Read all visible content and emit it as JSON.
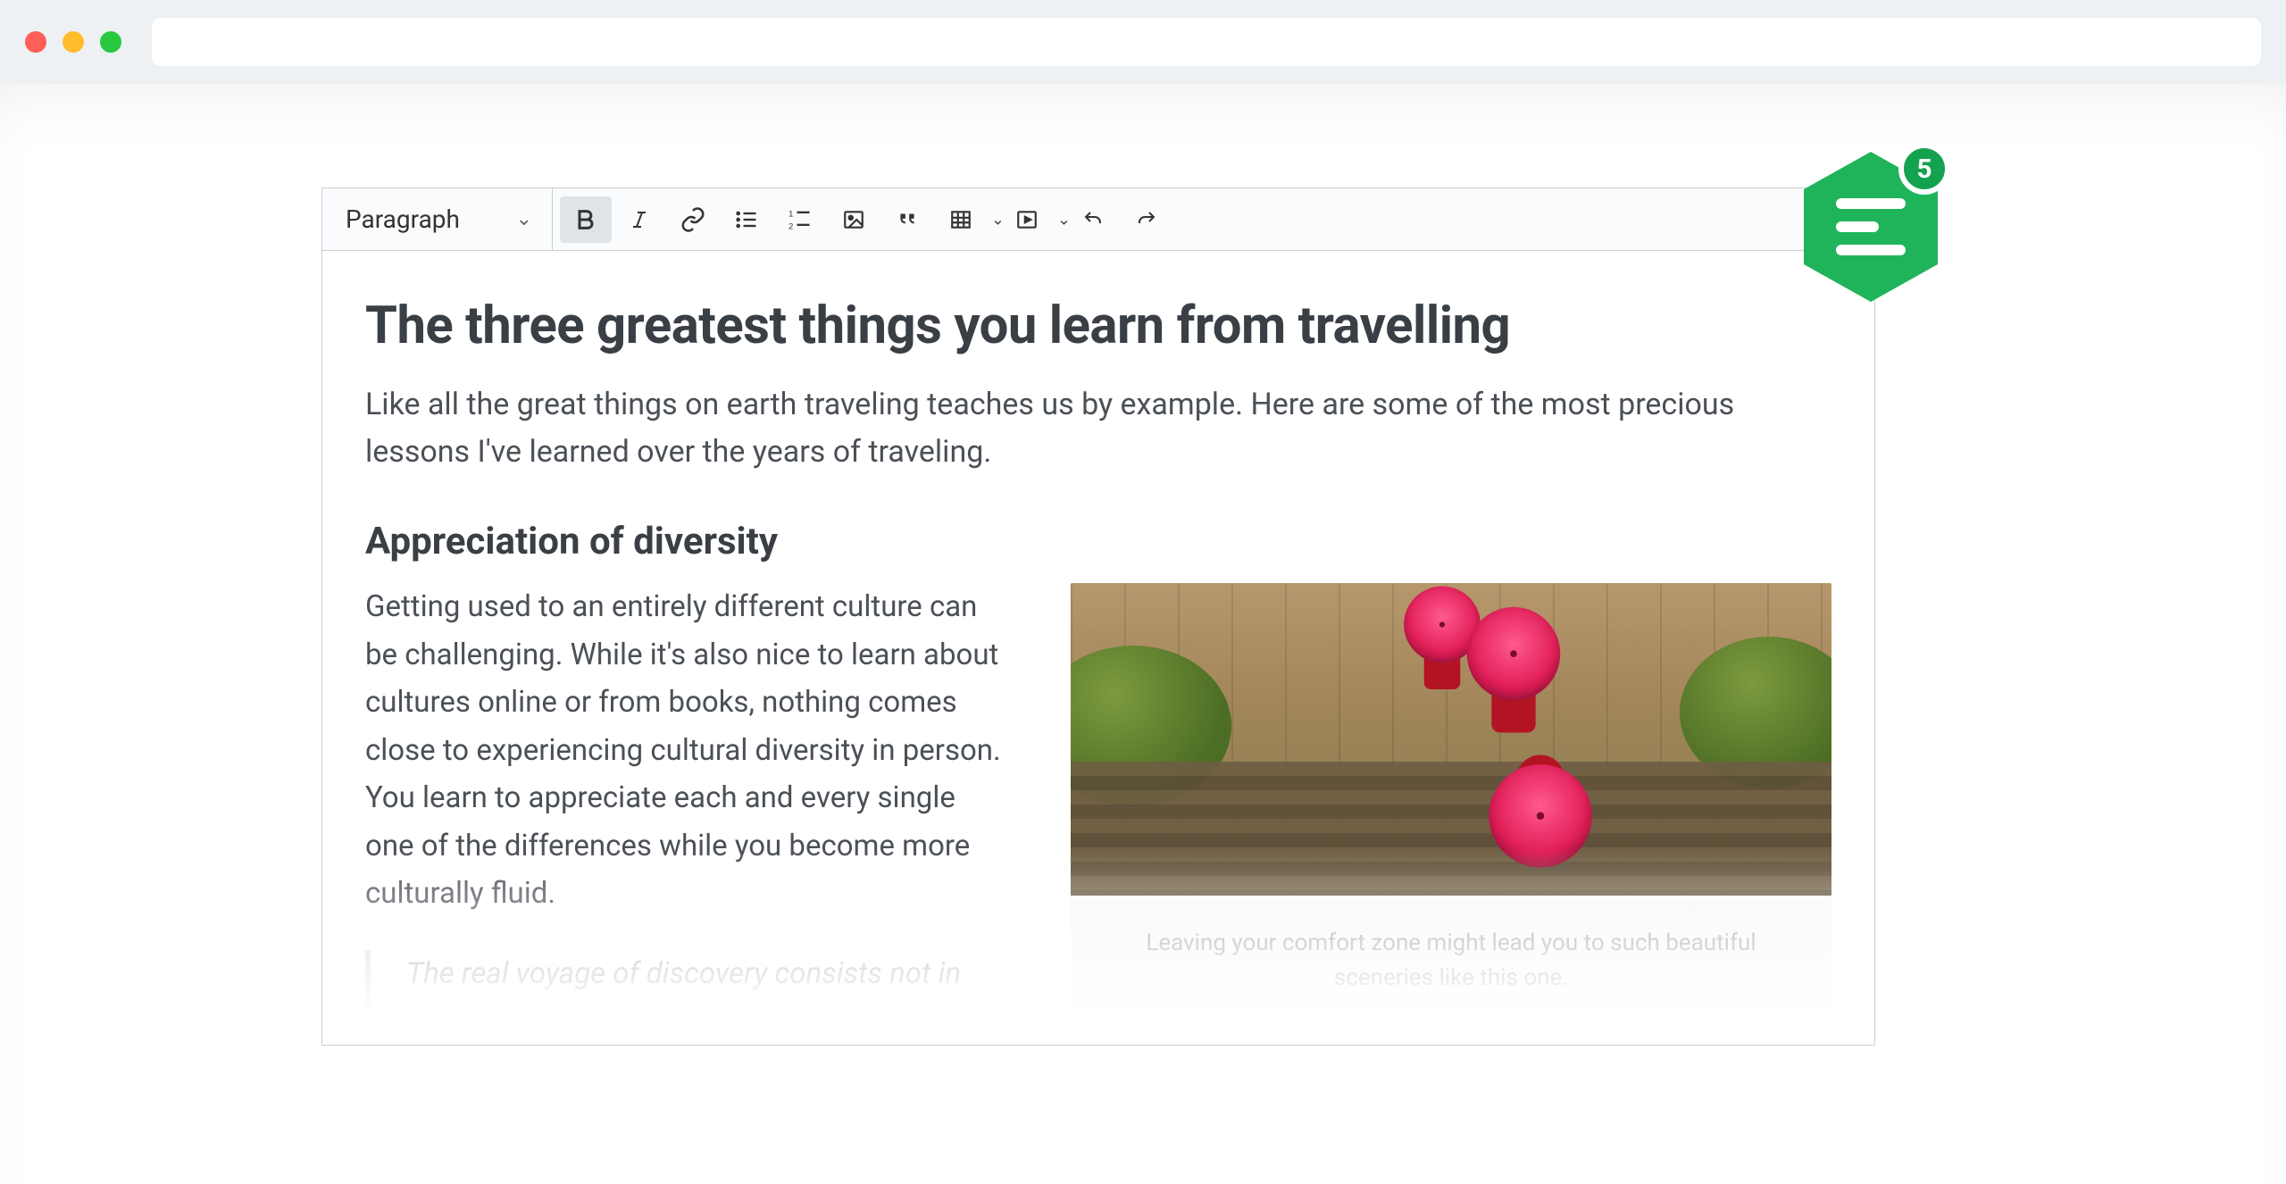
{
  "toolbar": {
    "block_format": "Paragraph",
    "buttons": [
      {
        "name": "bold",
        "active": true
      },
      {
        "name": "italic",
        "active": false
      },
      {
        "name": "link",
        "active": false
      },
      {
        "name": "bulleted-list",
        "active": false
      },
      {
        "name": "numbered-list",
        "active": false
      },
      {
        "name": "image",
        "active": false
      },
      {
        "name": "blockquote",
        "active": false
      },
      {
        "name": "table",
        "active": false,
        "dropdown": true
      },
      {
        "name": "media",
        "active": false,
        "dropdown": true
      },
      {
        "name": "undo",
        "active": false
      },
      {
        "name": "redo",
        "active": false
      }
    ]
  },
  "article": {
    "title": "The three greatest things you learn from travelling",
    "intro": "Like all the great things on earth traveling teaches us by example. Here are some of the most precious lessons I've learned over the years of traveling.",
    "section_heading": "Appreciation of diversity",
    "section_body": "Getting used to an entirely different culture can be challenging. While it's also nice to learn about cultures online or from books, nothing comes close to experiencing cultural diversity in person. You learn to appreciate each and every single one of the differences while you become more culturally fluid.",
    "quote": "The real voyage of discovery consists not in seeking new landscapes, but having new eyes.",
    "figure_caption": "Leaving your comfort zone might lead you to such beautiful sceneries like this one."
  },
  "badge": {
    "count": "5"
  },
  "colors": {
    "accent_green": "#1fb45a",
    "text_primary": "#3a3f45",
    "text_muted": "#9aa0a6"
  }
}
